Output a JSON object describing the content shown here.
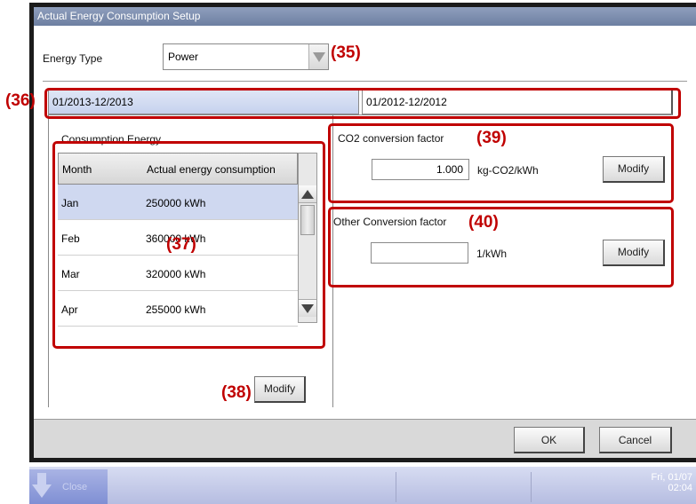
{
  "window": {
    "title": "Actual Energy Consumption Setup"
  },
  "energy_type": {
    "label": "Energy Type",
    "value": "Power"
  },
  "tabs": [
    {
      "label": "01/2013-12/2013",
      "active": true
    },
    {
      "label": "01/2012-12/2012",
      "active": false
    }
  ],
  "consumption": {
    "title": "Consumption Energy",
    "columns": [
      "Month",
      "Actual energy consumption"
    ],
    "rows": [
      {
        "month": "Jan",
        "value": "250000 kWh",
        "selected": true
      },
      {
        "month": "Feb",
        "value": "360000 kWh",
        "selected": false
      },
      {
        "month": "Mar",
        "value": "320000 kWh",
        "selected": false
      },
      {
        "month": "Apr",
        "value": "255000 kWh",
        "selected": false
      }
    ],
    "modify_label": "Modify"
  },
  "co2": {
    "title": "CO2 conversion factor",
    "value": "1.000",
    "unit": "kg-CO2/kWh",
    "modify_label": "Modify"
  },
  "other": {
    "title": "Other Conversion factor",
    "value": "",
    "unit": "1/kWh",
    "modify_label": "Modify"
  },
  "footer": {
    "ok_label": "OK",
    "cancel_label": "Cancel"
  },
  "taskbar": {
    "close_label": "Close",
    "date": "Fri, 01/07",
    "time": "02:04"
  },
  "annotations": {
    "a35": "(35)",
    "a36": "(36)",
    "a37": "(37)",
    "a38": "(38)",
    "a39": "(39)",
    "a40": "(40)"
  },
  "colors": {
    "annotation": "#c00000",
    "titlebar": "#7a8bab",
    "selected_row": "#cfd8f0"
  }
}
